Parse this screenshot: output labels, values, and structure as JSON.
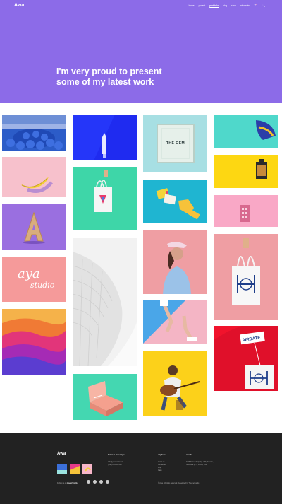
{
  "brand": {
    "logo": "Awa"
  },
  "nav": {
    "items": [
      "home",
      "project",
      "portfolio",
      "blog",
      "shop",
      "elements"
    ],
    "active_index": 2
  },
  "hero": {
    "line1": "I'm very proud to present",
    "line2": "some of my latest work",
    "bg_color": "#8c6be8"
  },
  "portfolio_grid": {
    "tiles": [
      "blue-chairs",
      "banana",
      "gold-letter-a",
      "aya-studio",
      "color-waves",
      "rocket-blue",
      "tote-bag-green",
      "white-building",
      "pink-box",
      "the-gem-frame",
      "yellow-hand-cards",
      "woman-visor",
      "legs-sneakers",
      "guitar-man",
      "helmet-teal",
      "film-roll",
      "pink-device",
      "tote-bag-pink",
      "airdate-shirt"
    ],
    "aya_line1": "aya",
    "aya_line2": "studio",
    "gem_text": "THE GEM"
  },
  "footer": {
    "logo": "Awa",
    "thumbs_caption": "Follow us on",
    "thumbs_caption_brand": "#awaphotolife",
    "col1_head": "leave a message",
    "col1_lines": [
      "info@youremail.com",
      "(+88) 1234567890"
    ],
    "col2_head": "explore",
    "col2_lines": [
      "About us",
      "Contact us",
      "Blog",
      "Case"
    ],
    "col3_head": "studio",
    "col3_lines": [
      "4096 Sunset Strip Apt. 896, Arcadia,",
      "New York (NY), 10001, USA"
    ],
    "copyright": "© Awa. All rights reserved. Developed by ThemeGoods",
    "social_icons": [
      "facebook-icon",
      "twitter-icon",
      "instagram-icon",
      "pinterest-icon"
    ]
  }
}
